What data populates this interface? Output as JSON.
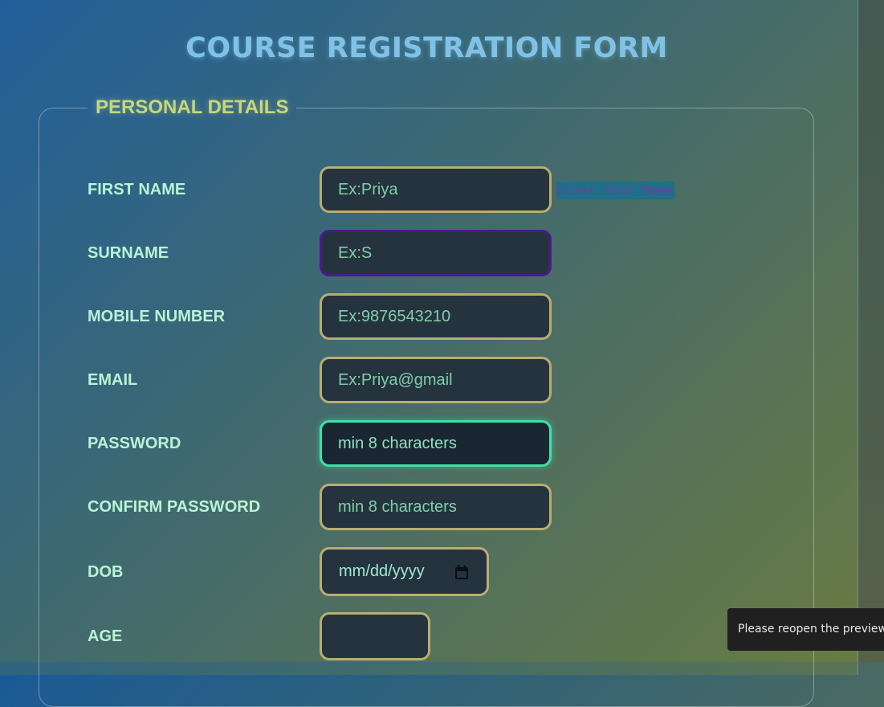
{
  "form": {
    "title": "COURSE REGISTRATION FORM",
    "section_title": "PERSONAL DETAILS",
    "first_name": {
      "label": "FIRST NAME",
      "placeholder": "Ex:Priya",
      "hint": "Enter Your Name"
    },
    "surname": {
      "label": "SURNAME",
      "placeholder": "Ex:S"
    },
    "mobile": {
      "label": "MOBILE NUMBER",
      "placeholder": "Ex:9876543210"
    },
    "email": {
      "label": "EMAIL",
      "placeholder": "Ex:Priya@gmail"
    },
    "password": {
      "label": "PASSWORD",
      "placeholder": "min 8 characters"
    },
    "confirm_password": {
      "label": "CONFIRM PASSWORD",
      "placeholder": "min 8 characters"
    },
    "dob": {
      "label": "DOB",
      "placeholder": "mm/dd/yyyy",
      "icon": "calendar-icon"
    },
    "age": {
      "label": "AGE",
      "value": ""
    }
  },
  "toast": {
    "message": "Please reopen the preview."
  },
  "colors": {
    "title": "#7fc2e6",
    "section_title": "#c8d67a",
    "label": "#b9f3d4",
    "input_border": "#b9ad72",
    "input_border_surname": "#4b1a8d",
    "input_border_focused": "#3fe0a6",
    "hint_background": "#1f6f86",
    "hint_text": "#6a3fa8"
  }
}
